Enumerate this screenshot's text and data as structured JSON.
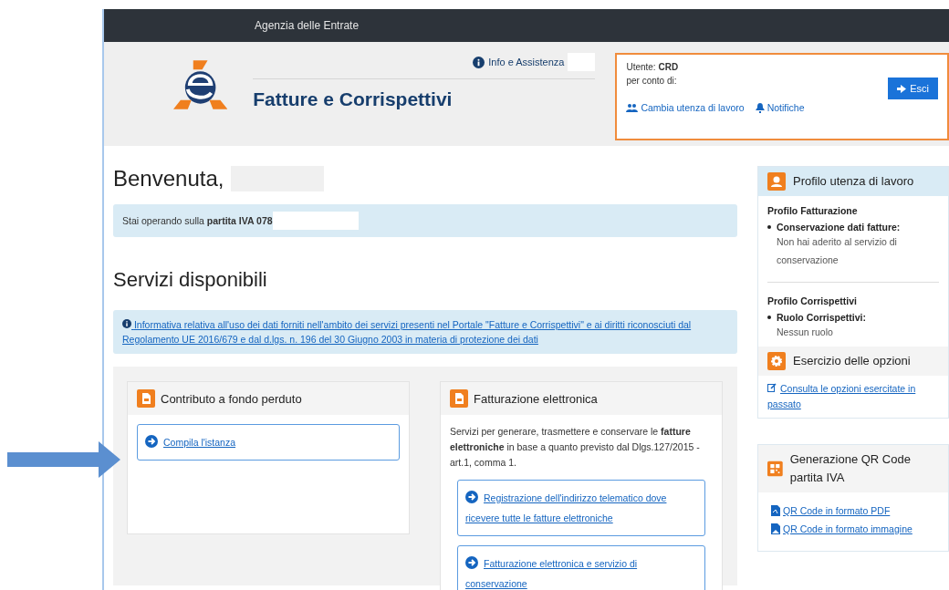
{
  "top_bar": {
    "title": "Agenzia delle Entrate"
  },
  "header": {
    "brand": "Fatture e Corrispettivi",
    "info_link": "Info e Assistenza",
    "user_box": {
      "user_label": "Utente:",
      "user_value": "CRD",
      "on_behalf": "per conto di:",
      "links": [
        {
          "kind": "users",
          "label": "Cambia utenza di lavoro"
        },
        {
          "kind": "bell",
          "label": "Notifiche"
        }
      ],
      "logout": "Esci"
    }
  },
  "welcome": "Benvenuta,",
  "vat_notice": "Stai operando sulla **partita IVA 078**",
  "services_title": "Servizi disponibili",
  "privacy_notice": "Informativa relativa all'uso dei dati forniti nell'ambito dei servizi presenti nel Portale \"Fatture e Corrispettivi\" e ai diritti riconosciuti dal Regolamento UE 2016/679 e dal d.lgs. n. 196 del 30 Giugno 2003 in materia di protezione dei dati",
  "service_cards": [
    {
      "title": "Contributo a fondo perduto",
      "links": [
        "Compila l'istanza"
      ]
    },
    {
      "title": "Fatturazione elettronica",
      "description": "Servizi per generare, trasmettere e conservare le **fatture elettroniche** in base a quanto previsto dal Dlgs.127/2015 - art.1, comma 1.",
      "links": [
        "Registrazione dell'indirizzo telematico dove ricevere tutte le fatture elettroniche",
        "Fatturazione elettronica e servizio di conservazione"
      ]
    }
  ],
  "sidebar": {
    "profile": {
      "title": "Profilo utenza di lavoro",
      "sections": [
        {
          "heading": "Profilo Fatturazione",
          "label": "Conservazione dati fatture:",
          "value": "Non hai aderito al servizio di conservazione"
        },
        {
          "heading": "Profilo Corrispettivi",
          "label": "Ruolo Corrispettivi:",
          "value": "Nessun ruolo"
        }
      ]
    },
    "options": {
      "title": "Esercizio delle opzioni",
      "links": [
        "Consulta le opzioni esercitate in passato"
      ]
    },
    "qr": {
      "title": "Generazione QR Code partita IVA",
      "links": [
        {
          "kind": "pdf",
          "label": "QR Code in formato PDF"
        },
        {
          "kind": "image",
          "label": "QR Code in formato immagine"
        }
      ]
    }
  }
}
